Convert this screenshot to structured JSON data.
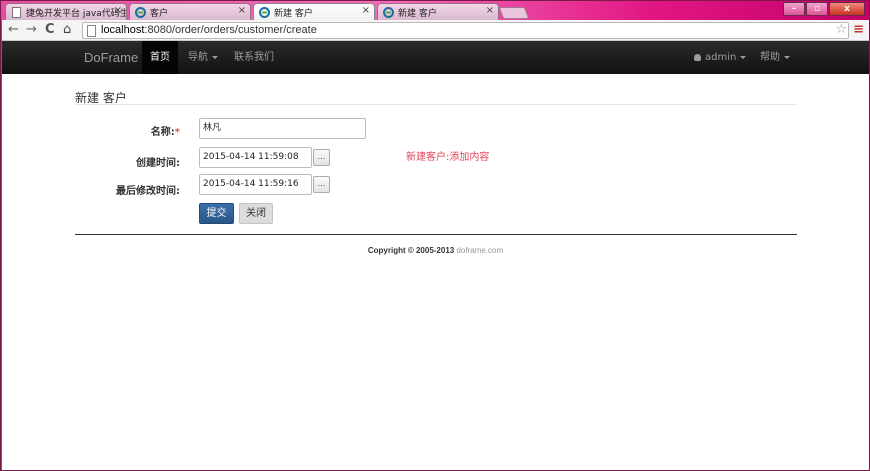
{
  "browser": {
    "tabs": [
      {
        "title": "捷兔开发平台 java代码生",
        "active": false
      },
      {
        "title": "客户",
        "active": false
      },
      {
        "title": "新建 客户",
        "active": true
      },
      {
        "title": "新建 客户",
        "active": false
      }
    ],
    "address": {
      "host": "localhost",
      "path": ":8080/order/orders/customer/create"
    },
    "icons": {
      "back": "←",
      "forward": "→",
      "reload": "C",
      "home": "⌂",
      "star": "☆",
      "menu": "≡"
    },
    "window_buttons": {
      "minimize": "–",
      "maximize": "▫",
      "close": "x"
    }
  },
  "navbar": {
    "brand": "DoFrame",
    "home": "首页",
    "guide": "导航",
    "contact": "联系我们",
    "user": "admin",
    "help": "帮助"
  },
  "form": {
    "title": "新建 客户",
    "name_label": "名称:",
    "name_required_mark": "*",
    "name_value": "林凡",
    "created_label": "创建时间:",
    "created_value": "2015-04-14 11:59:08",
    "modified_label": "最后修改时间:",
    "modified_value": "2015-04-14 11:59:16",
    "picker_label": "...",
    "submit_label": "提交",
    "close_label": "关闭"
  },
  "note": "新建客户:添加内容",
  "footer": {
    "copyright": "Copyright © 2005-2013 ",
    "link": "doframe.com"
  },
  "colors": {
    "navbar": "#1b1b1b",
    "primary": "#2f5f96",
    "note": "#e0455a",
    "chrome": "#d8257f"
  }
}
